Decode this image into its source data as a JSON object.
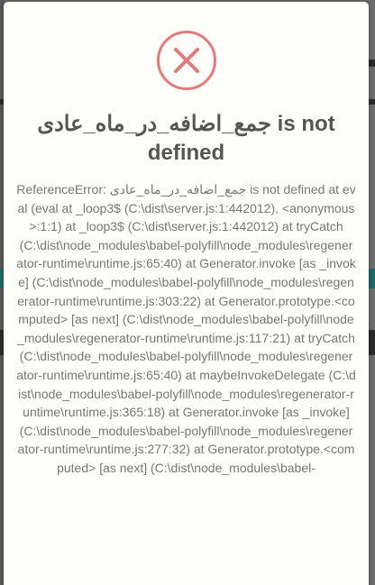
{
  "modal": {
    "icon": "close-icon",
    "title": "جمع_اضافه_در_ماه_عادی is not defined",
    "message": "ReferenceError: جمع_اضافه_در_ماه_عادی is not defined at eval (eval at _loop3$ (C:\\dist\\server.js:1:442012), <anonymous>:1:1) at _loop3$ (C:\\dist\\server.js:1:442012) at tryCatch (C:\\dist\\node_modules\\babel-polyfill\\node_modules\\regenerator-runtime\\runtime.js:65:40) at Generator.invoke [as _invoke] (C:\\dist\\node_modules\\babel-polyfill\\node_modules\\regenerator-runtime\\runtime.js:303:22) at Generator.prototype.<computed> [as next] (C:\\dist\\node_modules\\babel-polyfill\\node_modules\\regenerator-runtime\\runtime.js:117:21) at tryCatch (C:\\dist\\node_modules\\babel-polyfill\\node_modules\\regenerator-runtime\\runtime.js:65:40) at maybeInvokeDelegate (C:\\dist\\node_modules\\babel-polyfill\\node_modules\\regenerator-runtime\\runtime.js:365:18) at Generator.invoke [as _invoke] (C:\\dist\\node_modules\\babel-polyfill\\node_modules\\regenerator-runtime\\runtime.js:277:32) at Generator.prototype.<computed> [as next] (C:\\dist\\node_modules\\babel-"
  },
  "colors": {
    "icon_stroke": "#e27c7c",
    "title": "#555555",
    "body": "#767676",
    "modal_bg": "#fefefa",
    "overlay": "#6b6b6b"
  }
}
